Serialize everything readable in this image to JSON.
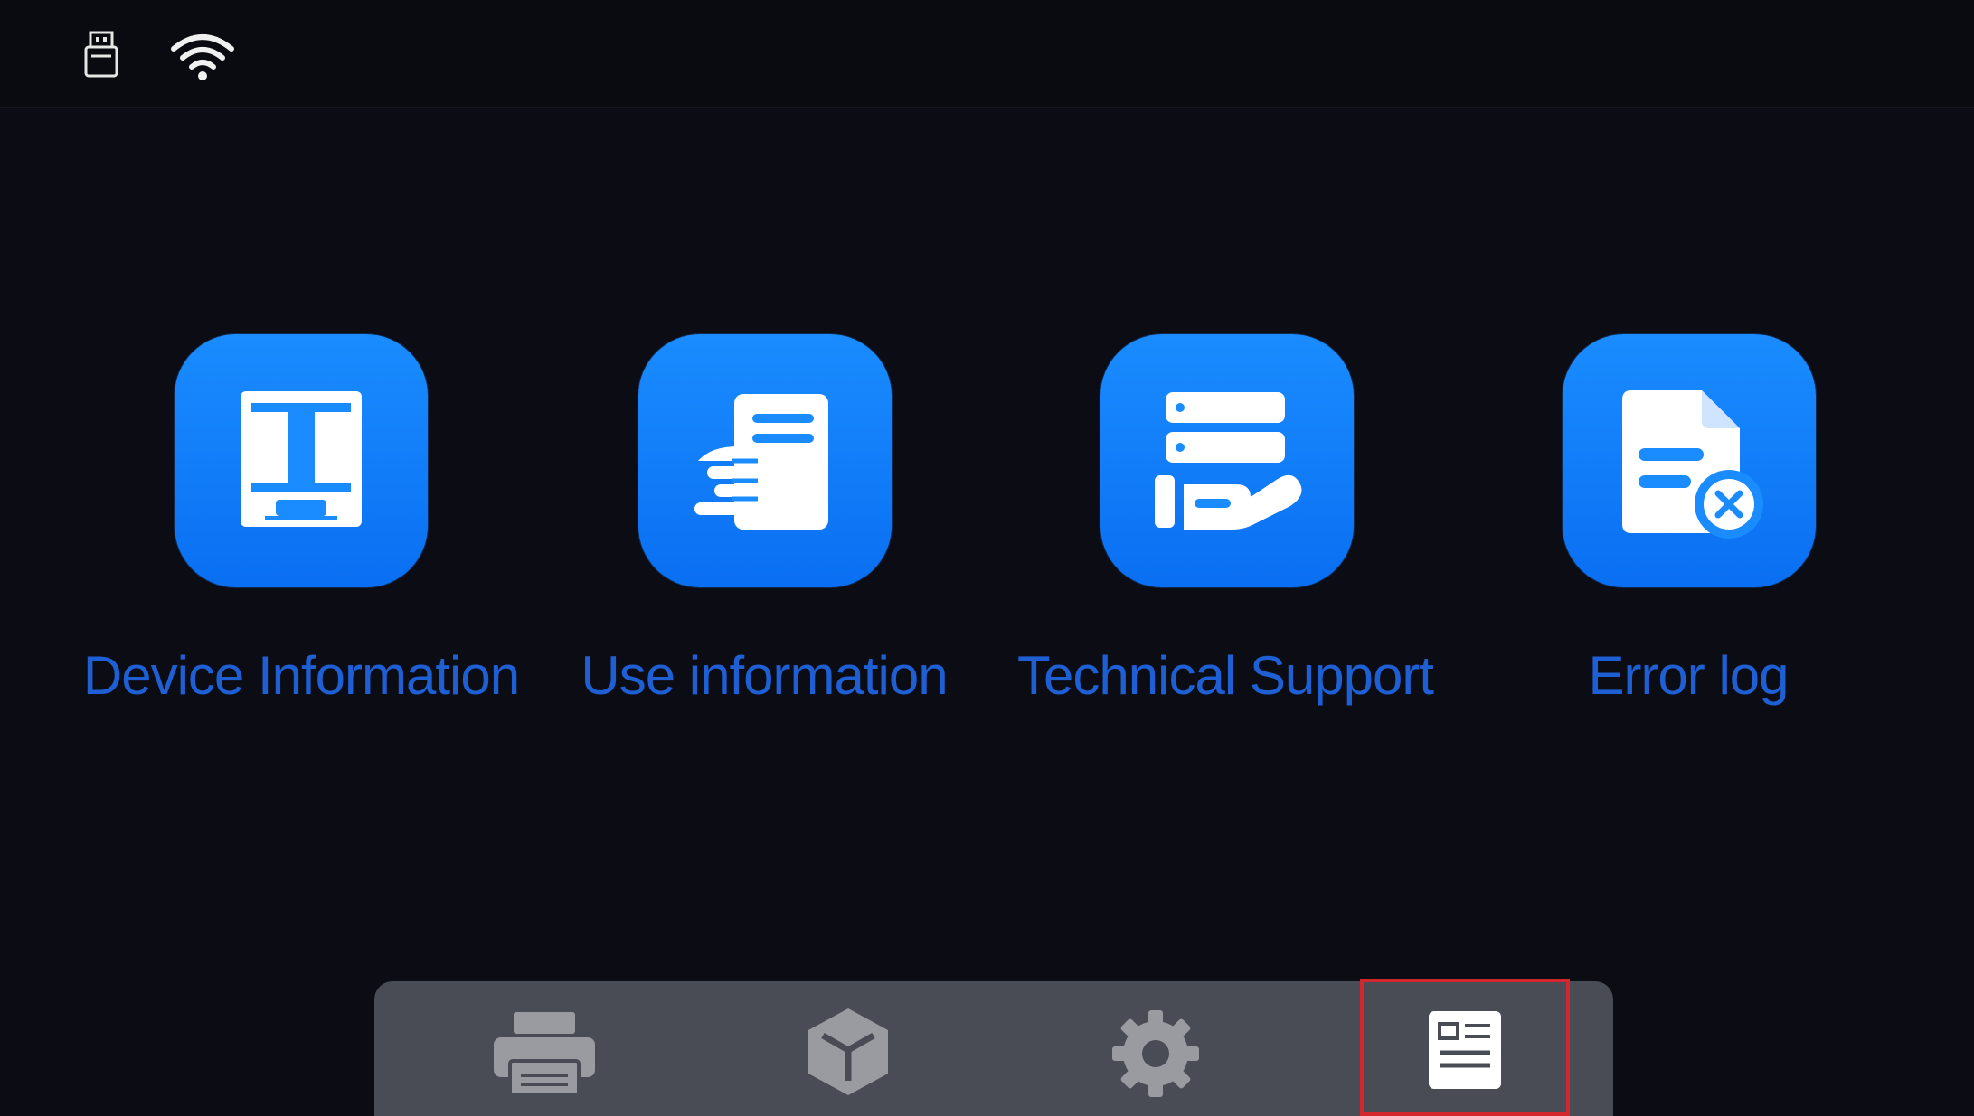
{
  "status_bar": {
    "icons": [
      "usb-drive-icon",
      "wifi-icon"
    ]
  },
  "menu": {
    "tiles": [
      {
        "id": "device-information",
        "label": "Device Information",
        "icon": "printer-device-icon"
      },
      {
        "id": "use-information",
        "label": "Use information",
        "icon": "hand-document-icon"
      },
      {
        "id": "technical-support",
        "label": "Technical Support",
        "icon": "server-hand-icon"
      },
      {
        "id": "error-log",
        "label": "Error log",
        "icon": "document-error-icon"
      }
    ]
  },
  "bottom_nav": {
    "items": [
      {
        "id": "print",
        "icon": "printer-icon"
      },
      {
        "id": "model",
        "icon": "cube-icon"
      },
      {
        "id": "settings",
        "icon": "gear-icon"
      },
      {
        "id": "info",
        "icon": "info-card-icon",
        "selected": true
      }
    ]
  },
  "colors": {
    "background": "#0b0c14",
    "tile_blue": "#1a8cff",
    "label_blue": "#1f5fd4",
    "nav_bg": "#4a4c55",
    "nav_icon": "#9a9ba1",
    "selected_outline": "#d4262d"
  }
}
